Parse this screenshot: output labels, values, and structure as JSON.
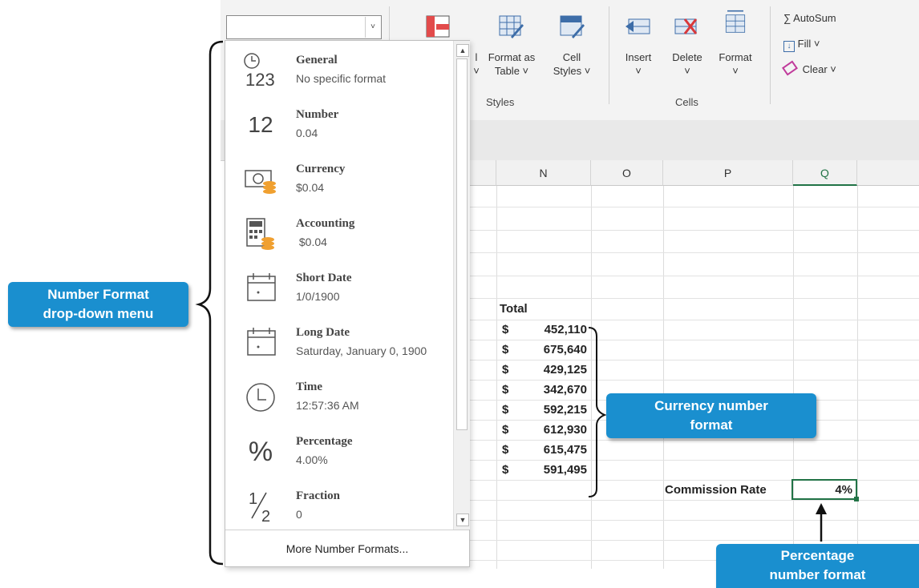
{
  "ribbon": {
    "styles_group": {
      "label": "Styles",
      "format_as_table": [
        "Format as",
        "Table ˅"
      ],
      "cell_styles": [
        "Cell",
        "Styles ˅"
      ],
      "partial": [
        "l",
        "˅"
      ]
    },
    "cells_group": {
      "label": "Cells",
      "insert": [
        "Insert",
        "˅"
      ],
      "delete": [
        "Delete",
        "˅"
      ],
      "format": [
        "Format",
        "˅"
      ]
    },
    "editing": {
      "autosum": "∑ AutoSum",
      "fill": "Fill ˅",
      "clear": "Clear ˅"
    }
  },
  "number_format_select": {
    "value": "",
    "arrow": "˅"
  },
  "columns": [
    "N",
    "O",
    "P",
    "Q"
  ],
  "dropdown": {
    "items": [
      {
        "name": "General",
        "sample": "No specific format",
        "icon": "general-clock-123-icon"
      },
      {
        "name": "Number",
        "sample": "0.04",
        "icon": "number-12-icon"
      },
      {
        "name": "Currency",
        "sample": "$0.04",
        "icon": "currency-icon"
      },
      {
        "name": "Accounting",
        "sample": " $0.04",
        "icon": "accounting-icon"
      },
      {
        "name": "Short Date",
        "sample": "1/0/1900",
        "icon": "calendar-icon"
      },
      {
        "name": "Long Date",
        "sample": "Saturday, January 0, 1900",
        "icon": "calendar-icon"
      },
      {
        "name": "Time",
        "sample": "12:57:36 AM",
        "icon": "clock-icon"
      },
      {
        "name": "Percentage",
        "sample": "4.00%",
        "icon": "percent-icon"
      },
      {
        "name": "Fraction",
        "sample": "0",
        "icon": "fraction-icon"
      }
    ],
    "more": "More Number Formats..."
  },
  "sheet": {
    "total_label": "Total",
    "currency_symbol": "$",
    "totals": [
      "452,110",
      "675,640",
      "429,125",
      "342,670",
      "592,215",
      "612,930",
      "615,475",
      "591,495"
    ],
    "commission_label": "Commission Rate",
    "commission_value": "4%"
  },
  "callouts": {
    "number_format": [
      "Number Format",
      "drop-down menu"
    ],
    "currency": [
      "Currency number",
      "format"
    ],
    "percentage": [
      "Percentage",
      "number format"
    ]
  },
  "colors": {
    "callout": "#1a8fcf",
    "selected_cell": "#217346",
    "currency_icon_coin": "#f0a030"
  }
}
